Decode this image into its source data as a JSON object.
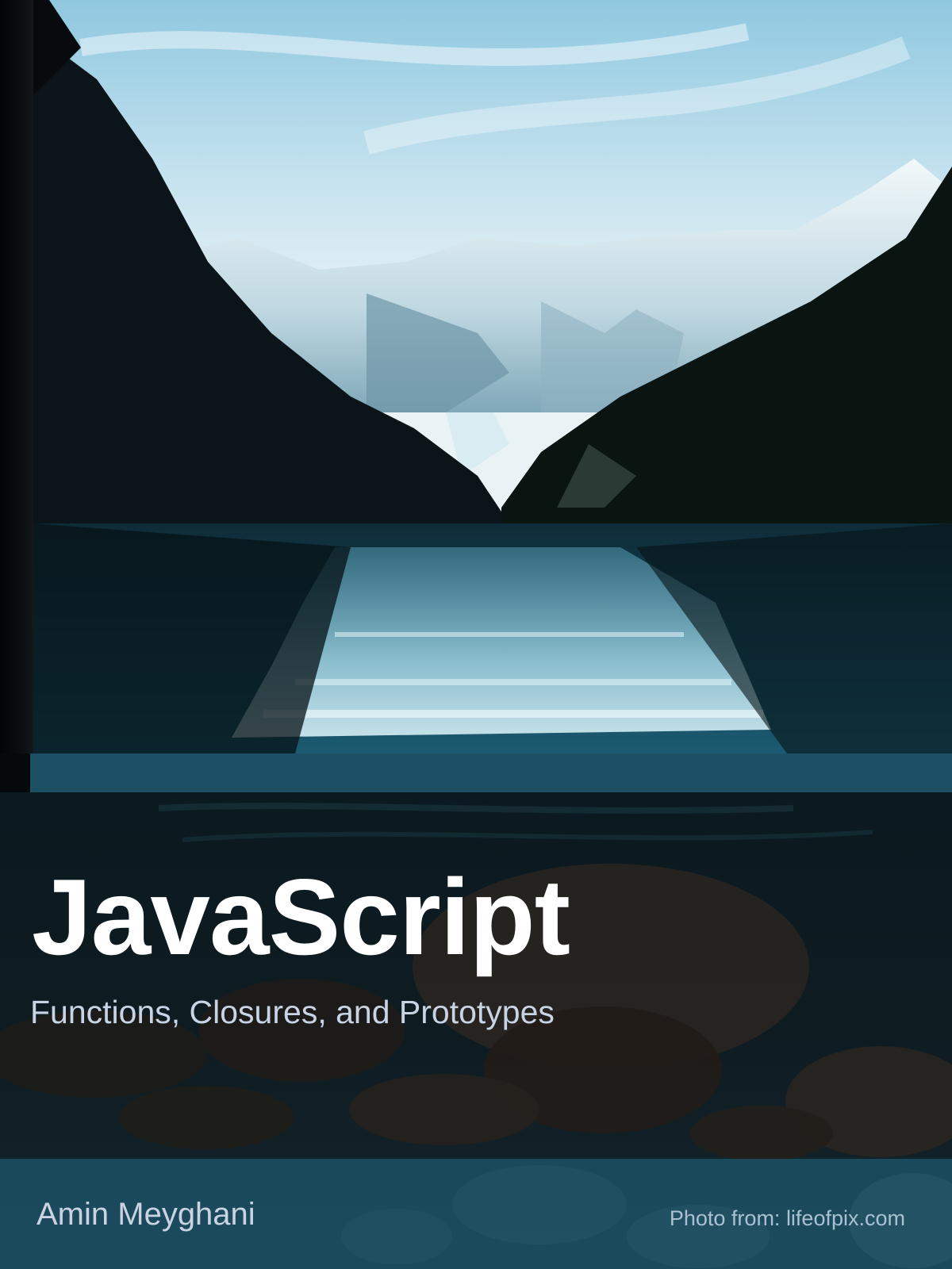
{
  "cover": {
    "title": "JavaScript",
    "subtitle": "Functions, Closures, and Prototypes",
    "author": "Amin Meyghani",
    "photo_credit": "Photo from: lifeofpix.com"
  },
  "colors": {
    "band": "#1d5064",
    "footer": "#1e546a",
    "title": "#ffffff",
    "subtitle": "#c8d3e4",
    "credit": "#a9c1d1"
  }
}
